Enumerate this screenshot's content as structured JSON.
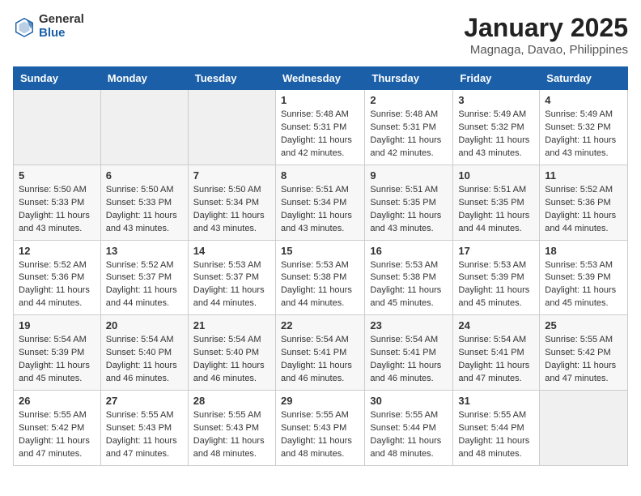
{
  "header": {
    "logo_general": "General",
    "logo_blue": "Blue",
    "month_title": "January 2025",
    "location": "Magnaga, Davao, Philippines"
  },
  "weekdays": [
    "Sunday",
    "Monday",
    "Tuesday",
    "Wednesday",
    "Thursday",
    "Friday",
    "Saturday"
  ],
  "weeks": [
    [
      {
        "day": "",
        "info": ""
      },
      {
        "day": "",
        "info": ""
      },
      {
        "day": "",
        "info": ""
      },
      {
        "day": "1",
        "info": "Sunrise: 5:48 AM\nSunset: 5:31 PM\nDaylight: 11 hours\nand 42 minutes."
      },
      {
        "day": "2",
        "info": "Sunrise: 5:48 AM\nSunset: 5:31 PM\nDaylight: 11 hours\nand 42 minutes."
      },
      {
        "day": "3",
        "info": "Sunrise: 5:49 AM\nSunset: 5:32 PM\nDaylight: 11 hours\nand 43 minutes."
      },
      {
        "day": "4",
        "info": "Sunrise: 5:49 AM\nSunset: 5:32 PM\nDaylight: 11 hours\nand 43 minutes."
      }
    ],
    [
      {
        "day": "5",
        "info": "Sunrise: 5:50 AM\nSunset: 5:33 PM\nDaylight: 11 hours\nand 43 minutes."
      },
      {
        "day": "6",
        "info": "Sunrise: 5:50 AM\nSunset: 5:33 PM\nDaylight: 11 hours\nand 43 minutes."
      },
      {
        "day": "7",
        "info": "Sunrise: 5:50 AM\nSunset: 5:34 PM\nDaylight: 11 hours\nand 43 minutes."
      },
      {
        "day": "8",
        "info": "Sunrise: 5:51 AM\nSunset: 5:34 PM\nDaylight: 11 hours\nand 43 minutes."
      },
      {
        "day": "9",
        "info": "Sunrise: 5:51 AM\nSunset: 5:35 PM\nDaylight: 11 hours\nand 43 minutes."
      },
      {
        "day": "10",
        "info": "Sunrise: 5:51 AM\nSunset: 5:35 PM\nDaylight: 11 hours\nand 44 minutes."
      },
      {
        "day": "11",
        "info": "Sunrise: 5:52 AM\nSunset: 5:36 PM\nDaylight: 11 hours\nand 44 minutes."
      }
    ],
    [
      {
        "day": "12",
        "info": "Sunrise: 5:52 AM\nSunset: 5:36 PM\nDaylight: 11 hours\nand 44 minutes."
      },
      {
        "day": "13",
        "info": "Sunrise: 5:52 AM\nSunset: 5:37 PM\nDaylight: 11 hours\nand 44 minutes."
      },
      {
        "day": "14",
        "info": "Sunrise: 5:53 AM\nSunset: 5:37 PM\nDaylight: 11 hours\nand 44 minutes."
      },
      {
        "day": "15",
        "info": "Sunrise: 5:53 AM\nSunset: 5:38 PM\nDaylight: 11 hours\nand 44 minutes."
      },
      {
        "day": "16",
        "info": "Sunrise: 5:53 AM\nSunset: 5:38 PM\nDaylight: 11 hours\nand 45 minutes."
      },
      {
        "day": "17",
        "info": "Sunrise: 5:53 AM\nSunset: 5:39 PM\nDaylight: 11 hours\nand 45 minutes."
      },
      {
        "day": "18",
        "info": "Sunrise: 5:53 AM\nSunset: 5:39 PM\nDaylight: 11 hours\nand 45 minutes."
      }
    ],
    [
      {
        "day": "19",
        "info": "Sunrise: 5:54 AM\nSunset: 5:39 PM\nDaylight: 11 hours\nand 45 minutes."
      },
      {
        "day": "20",
        "info": "Sunrise: 5:54 AM\nSunset: 5:40 PM\nDaylight: 11 hours\nand 46 minutes."
      },
      {
        "day": "21",
        "info": "Sunrise: 5:54 AM\nSunset: 5:40 PM\nDaylight: 11 hours\nand 46 minutes."
      },
      {
        "day": "22",
        "info": "Sunrise: 5:54 AM\nSunset: 5:41 PM\nDaylight: 11 hours\nand 46 minutes."
      },
      {
        "day": "23",
        "info": "Sunrise: 5:54 AM\nSunset: 5:41 PM\nDaylight: 11 hours\nand 46 minutes."
      },
      {
        "day": "24",
        "info": "Sunrise: 5:54 AM\nSunset: 5:41 PM\nDaylight: 11 hours\nand 47 minutes."
      },
      {
        "day": "25",
        "info": "Sunrise: 5:55 AM\nSunset: 5:42 PM\nDaylight: 11 hours\nand 47 minutes."
      }
    ],
    [
      {
        "day": "26",
        "info": "Sunrise: 5:55 AM\nSunset: 5:42 PM\nDaylight: 11 hours\nand 47 minutes."
      },
      {
        "day": "27",
        "info": "Sunrise: 5:55 AM\nSunset: 5:43 PM\nDaylight: 11 hours\nand 47 minutes."
      },
      {
        "day": "28",
        "info": "Sunrise: 5:55 AM\nSunset: 5:43 PM\nDaylight: 11 hours\nand 48 minutes."
      },
      {
        "day": "29",
        "info": "Sunrise: 5:55 AM\nSunset: 5:43 PM\nDaylight: 11 hours\nand 48 minutes."
      },
      {
        "day": "30",
        "info": "Sunrise: 5:55 AM\nSunset: 5:44 PM\nDaylight: 11 hours\nand 48 minutes."
      },
      {
        "day": "31",
        "info": "Sunrise: 5:55 AM\nSunset: 5:44 PM\nDaylight: 11 hours\nand 48 minutes."
      },
      {
        "day": "",
        "info": ""
      }
    ]
  ]
}
